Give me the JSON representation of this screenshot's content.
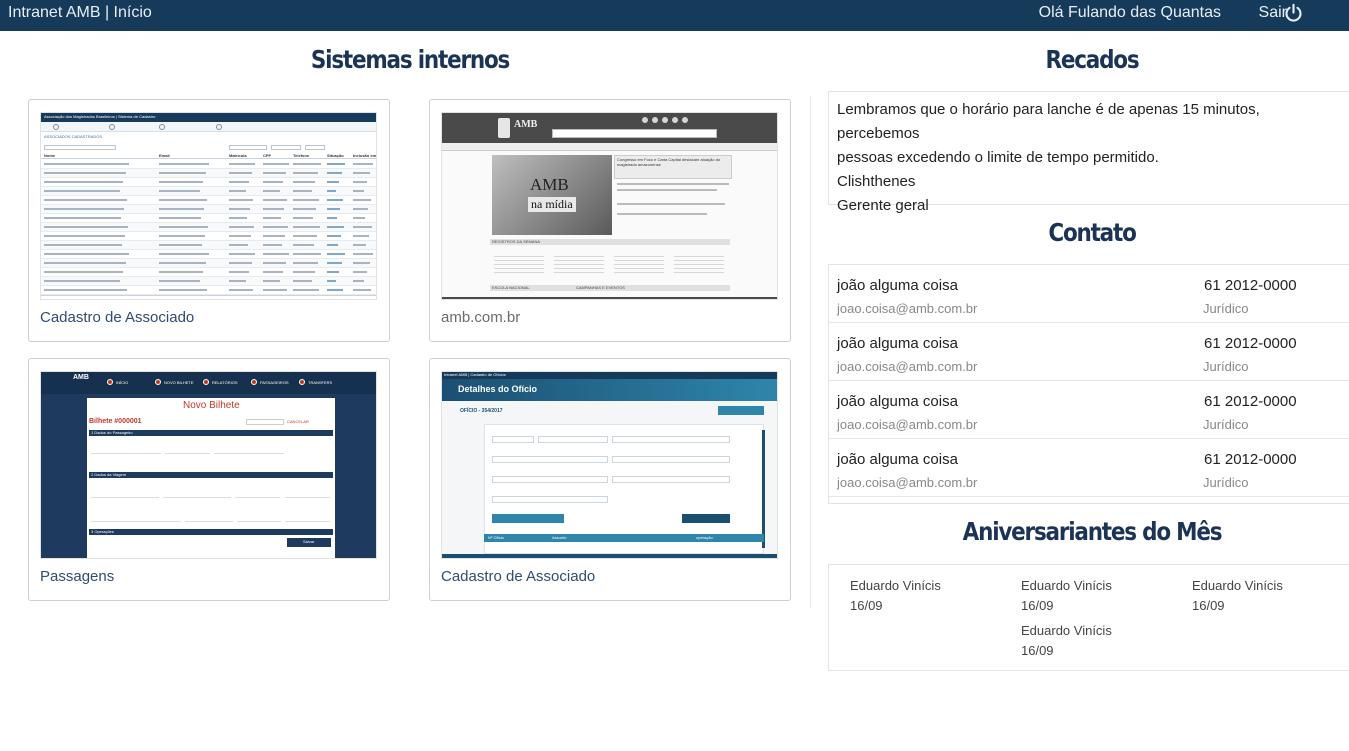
{
  "header": {
    "brand": "Intranet AMB | Início",
    "greeting": "Olá Fulando das Quantas",
    "logout_label": "Sair",
    "logout_icon": "power-icon",
    "bg_color": "#163a5a"
  },
  "systems": {
    "title": "Sistemas internos",
    "cards": [
      {
        "label": "Cadastro de Associado"
      },
      {
        "label": "amb.com.br"
      },
      {
        "label": "Passagens"
      },
      {
        "label": "Cadastro de Associado"
      }
    ]
  },
  "thumbs": {
    "cadastro": {
      "header": "Associação dos Magistrados Brasileiros | Sistema de Cadastro",
      "section": "ASSOCIADOS CADASTRADOS",
      "columns": [
        "Nome",
        "Email",
        "Matrícula",
        "CPF",
        "Telefone",
        "Situação",
        "Inclusão em"
      ]
    },
    "site": {
      "logo": "AMB",
      "banner_line1": "AMB",
      "banner_line2": "na mídia",
      "headline": "Congresso em Foco e Carta Capital destacam atuação do magistrado amazonense",
      "section1": "REGISTROS DA SEMANA",
      "section2": "ESCOLA NACIONAL",
      "section3": "CAMPANHAS E EVENTOS"
    },
    "passagens": {
      "logo": "AMB",
      "menu": [
        "INÍCIO",
        "NOVO BILHETE",
        "RELATÓRIOS",
        "PASSAGEIROS",
        "TRANSFERS"
      ],
      "form_title": "Novo Bilhete",
      "ticket": "Bilhete #000001",
      "cancel": "CANCELAR",
      "group1": "1 Dados do Passageiro",
      "group2": "2 Dados da Viagem",
      "group3": "3 Operações",
      "save": "Salvar"
    },
    "oficio": {
      "topbar": "Intranet AMB | Cadastro de Ofícios",
      "title": "Detalhes do Ofício",
      "number": "OFÍCIO - 354/2017",
      "col1": "Nº Ofício",
      "col2": "Assunto",
      "col3": "operação"
    }
  },
  "notices": {
    "title": "Recados",
    "lines": [
      "Lembramos que o horário para lanche é de apenas 15 minutos, percebemos",
      "pessoas excedendo o limite de tempo permitido.",
      "Clishthenes",
      "Gerente geral"
    ]
  },
  "contacts": {
    "title": "Contato",
    "items": [
      {
        "name": "joão alguma coisa",
        "phone": "61 2012-0000",
        "email": "joao.coisa@amb.com.br",
        "dept": "Jurídico"
      },
      {
        "name": "joão alguma coisa",
        "phone": "61 2012-0000",
        "email": "joao.coisa@amb.com.br",
        "dept": "Jurídico"
      },
      {
        "name": "joão alguma coisa",
        "phone": "61 2012-0000",
        "email": "joao.coisa@amb.com.br",
        "dept": "Jurídico"
      },
      {
        "name": "joão alguma coisa",
        "phone": "61 2012-0000",
        "email": "joao.coisa@amb.com.br",
        "dept": "Jurídico"
      }
    ]
  },
  "birthdays": {
    "title": "Aniversariantes do Mês",
    "items": [
      {
        "name": "Eduardo Vinícis",
        "date": "16/09"
      },
      {
        "name": "Eduardo Vinícis",
        "date": "16/09"
      },
      {
        "name": "Eduardo Vinícis",
        "date": "16/09"
      },
      {
        "name": "Eduardo Vinícis",
        "date": "16/09"
      }
    ]
  }
}
